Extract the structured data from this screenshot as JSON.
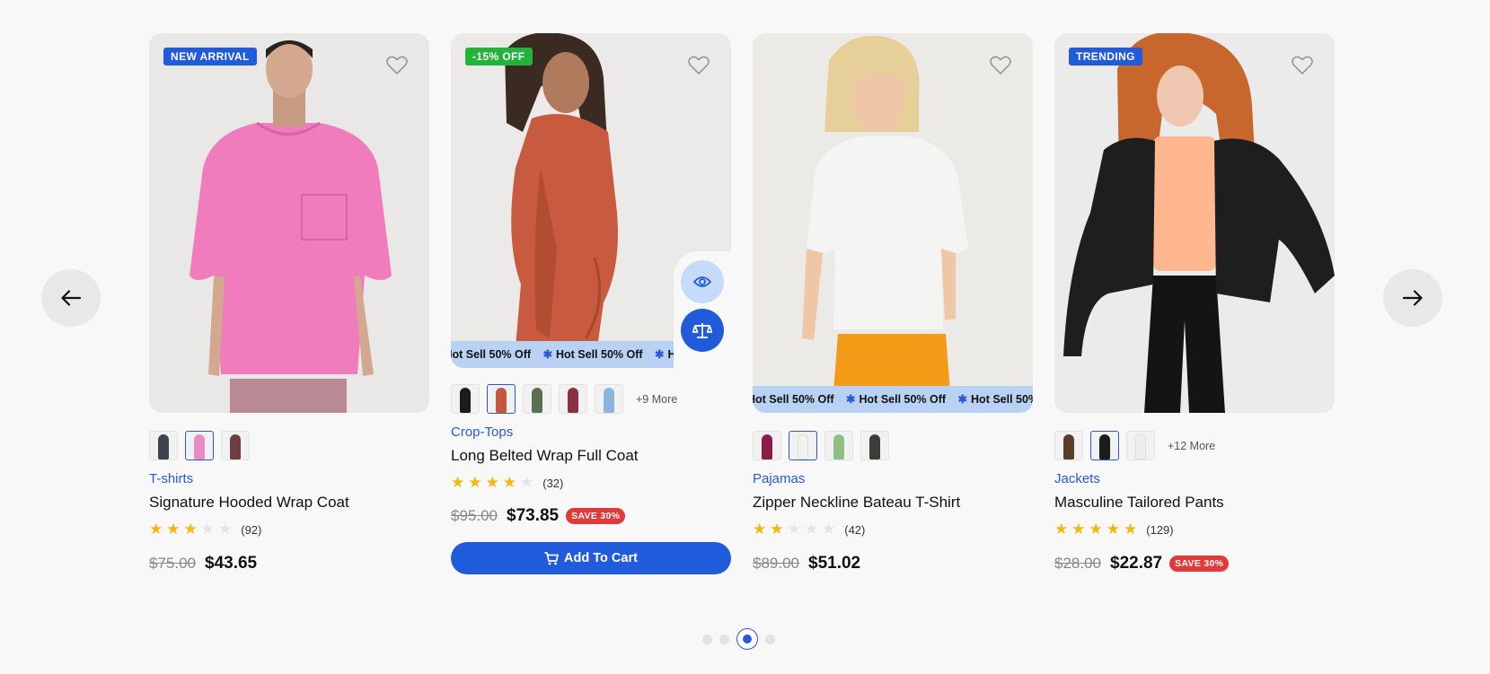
{
  "marquee_text": "Hot Sell 50% Off",
  "cart_label": "Add To Cart",
  "colors": {
    "accent": "#1f5bdb",
    "category": "#2a58d6",
    "badge_new": "#1f5bdb",
    "badge_sale": "#22b33a",
    "star": "#f6b60a",
    "save_badge": "#e23a3a"
  },
  "pagination": {
    "total": 4,
    "active_index": 2
  },
  "products": [
    {
      "badge": "NEW ARRIVAL",
      "category": "T-shirts",
      "title": "Signature Hooded Wrap Coat",
      "rating": 3,
      "reviews": "(92)",
      "old_price": "$75.00",
      "price": "$43.65",
      "save": "",
      "more": "",
      "swatches": [
        "#3f4350",
        "#e98bc4",
        "#6b3e42"
      ],
      "active_swatch": 1
    },
    {
      "badge": "-15% OFF",
      "category": "Crop-Tops",
      "title": "Long Belted Wrap Full Coat",
      "rating": 4,
      "reviews": "(32)",
      "old_price": "$95.00",
      "price": "$73.85",
      "save": "SAVE 30%",
      "more": "+9 More",
      "swatches": [
        "#1c1c1c",
        "#c6583f",
        "#5c6f56",
        "#8b3140",
        "#8bb6dc"
      ],
      "active_swatch": 1
    },
    {
      "badge": "",
      "category": "Pajamas",
      "title": "Zipper Neckline Bateau T-Shirt",
      "rating": 2,
      "reviews": "(42)",
      "old_price": "$89.00",
      "price": "$51.02",
      "save": "",
      "more": "",
      "swatches": [
        "#8b1e4a",
        "#f2f2ef",
        "#8fbf83",
        "#3d3d38"
      ],
      "active_swatch": 1
    },
    {
      "badge": "TRENDING",
      "category": "Jackets",
      "title": "Masculine Tailored Pants",
      "rating": 5,
      "reviews": "(129)",
      "old_price": "$28.00",
      "price": "$22.87",
      "save": "SAVE 30%",
      "more": "+12 More",
      "swatches": [
        "#5a3c2c",
        "#1c1c1c",
        "#eeeeea"
      ],
      "active_swatch": 1
    }
  ]
}
